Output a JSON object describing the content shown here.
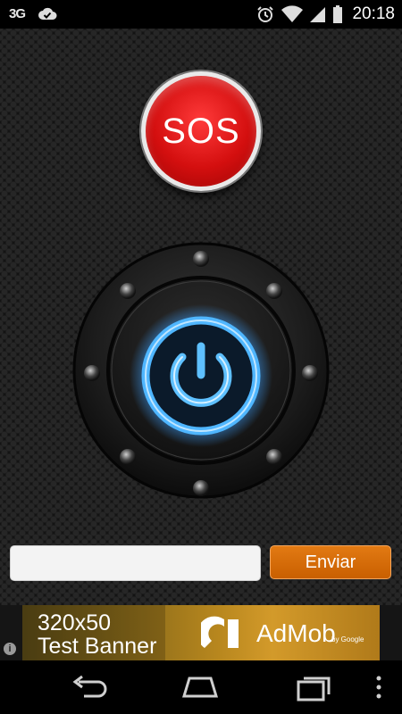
{
  "status_bar": {
    "network": "3G",
    "time": "20:18",
    "icons": [
      "check-icon",
      "alarm-icon",
      "wifi-icon",
      "signal-icon",
      "battery-icon"
    ]
  },
  "sos": {
    "label": "SOS",
    "color": "#d40f0f"
  },
  "power_button": {
    "icon": "power-icon",
    "glow_color": "#3aa8ff"
  },
  "message": {
    "value": "",
    "placeholder": ""
  },
  "send_button": {
    "label": "Enviar",
    "color": "#d66c08"
  },
  "ad": {
    "size": "320x50",
    "text": "Test Banner",
    "brand": "AdMob",
    "byline": "by Google",
    "info_icon": "i"
  },
  "nav": {
    "items": [
      "back-icon",
      "home-icon",
      "recents-icon",
      "menu-icon"
    ]
  }
}
